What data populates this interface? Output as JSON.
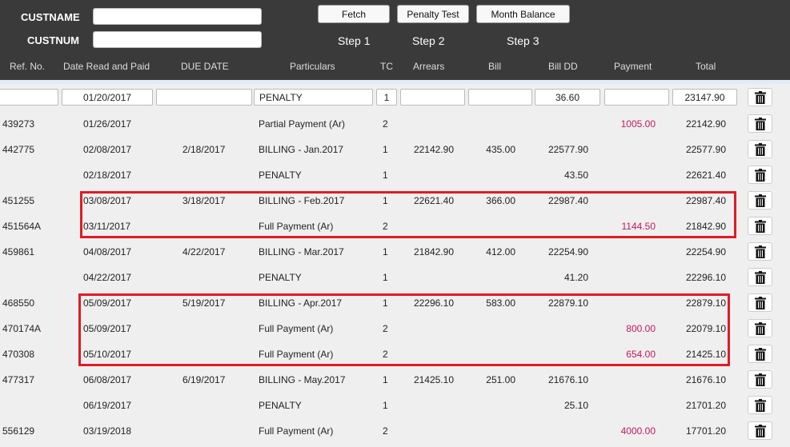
{
  "form": {
    "custname_label": "CUSTNAME",
    "custnum_label": "CUSTNUM",
    "custname_value": "",
    "custnum_value": ""
  },
  "buttons": {
    "fetch": "Fetch",
    "penalty_test": "Penalty Test",
    "month_balance": "Month Balance"
  },
  "steps": [
    "Step 1",
    "Step 2",
    "Step 3"
  ],
  "columns": [
    "Ref. No.",
    "Date Read and Paid",
    "DUE DATE",
    "Particulars",
    "TC",
    "Arrears",
    "Bill",
    "Bill DD",
    "Payment",
    "Total"
  ],
  "edit_row": {
    "ref": "",
    "date": "01/20/2017",
    "due": "",
    "particulars": "PENALTY",
    "tc": "1",
    "arrears": "",
    "bill": "",
    "bill_dd": "36.60",
    "payment": "",
    "total": "23147.90"
  },
  "rows": [
    {
      "ref": "439273",
      "date": "01/26/2017",
      "due": "",
      "particulars": "Partial Payment (Ar)",
      "tc": "2",
      "arrears": "",
      "bill": "",
      "bill_dd": "",
      "payment": "1005.00",
      "total": "22142.90"
    },
    {
      "ref": "442775",
      "date": "02/08/2017",
      "due": "2/18/2017",
      "particulars": "BILLING - Jan.2017",
      "tc": "1",
      "arrears": "22142.90",
      "bill": "435.00",
      "bill_dd": "22577.90",
      "payment": "",
      "total": "22577.90"
    },
    {
      "ref": "",
      "date": "02/18/2017",
      "due": "",
      "particulars": "PENALTY",
      "tc": "1",
      "arrears": "",
      "bill": "",
      "bill_dd": "43.50",
      "payment": "",
      "total": "22621.40"
    },
    {
      "ref": "451255",
      "date": "03/08/2017",
      "due": "3/18/2017",
      "particulars": "BILLING - Feb.2017",
      "tc": "1",
      "arrears": "22621.40",
      "bill": "366.00",
      "bill_dd": "22987.40",
      "payment": "",
      "total": "22987.40"
    },
    {
      "ref": "451564A",
      "date": "03/11/2017",
      "due": "",
      "particulars": "Full Payment (Ar)",
      "tc": "2",
      "arrears": "",
      "bill": "",
      "bill_dd": "",
      "payment": "1144.50",
      "total": "21842.90"
    },
    {
      "ref": "459861",
      "date": "04/08/2017",
      "due": "4/22/2017",
      "particulars": "BILLING - Mar.2017",
      "tc": "1",
      "arrears": "21842.90",
      "bill": "412.00",
      "bill_dd": "22254.90",
      "payment": "",
      "total": "22254.90"
    },
    {
      "ref": "",
      "date": "04/22/2017",
      "due": "",
      "particulars": "PENALTY",
      "tc": "1",
      "arrears": "",
      "bill": "",
      "bill_dd": "41.20",
      "payment": "",
      "total": "22296.10"
    },
    {
      "ref": "468550",
      "date": "05/09/2017",
      "due": "5/19/2017",
      "particulars": "BILLING - Apr.2017",
      "tc": "1",
      "arrears": "22296.10",
      "bill": "583.00",
      "bill_dd": "22879.10",
      "payment": "",
      "total": "22879.10"
    },
    {
      "ref": "470174A",
      "date": "05/09/2017",
      "due": "",
      "particulars": "Full Payment (Ar)",
      "tc": "2",
      "arrears": "",
      "bill": "",
      "bill_dd": "",
      "payment": "800.00",
      "total": "22079.10"
    },
    {
      "ref": "470308",
      "date": "05/10/2017",
      "due": "",
      "particulars": "Full Payment (Ar)",
      "tc": "2",
      "arrears": "",
      "bill": "",
      "bill_dd": "",
      "payment": "654.00",
      "total": "21425.10"
    },
    {
      "ref": "477317",
      "date": "06/08/2017",
      "due": "6/19/2017",
      "particulars": "BILLING - May.2017",
      "tc": "1",
      "arrears": "21425.10",
      "bill": "251.00",
      "bill_dd": "21676.10",
      "payment": "",
      "total": "21676.10"
    },
    {
      "ref": "",
      "date": "06/19/2017",
      "due": "",
      "particulars": "PENALTY",
      "tc": "1",
      "arrears": "",
      "bill": "",
      "bill_dd": "25.10",
      "payment": "",
      "total": "21701.20"
    },
    {
      "ref": "556129",
      "date": "03/19/2018",
      "due": "",
      "particulars": "Full Payment (Ar)",
      "tc": "2",
      "arrears": "",
      "bill": "",
      "bill_dd": "",
      "payment": "4000.00",
      "total": "17701.20"
    }
  ],
  "icons": {
    "delete": "trash-icon"
  },
  "colors": {
    "topbar": "#3a3a3a",
    "payment": "#c2185b",
    "highlight": "#e01b24"
  }
}
